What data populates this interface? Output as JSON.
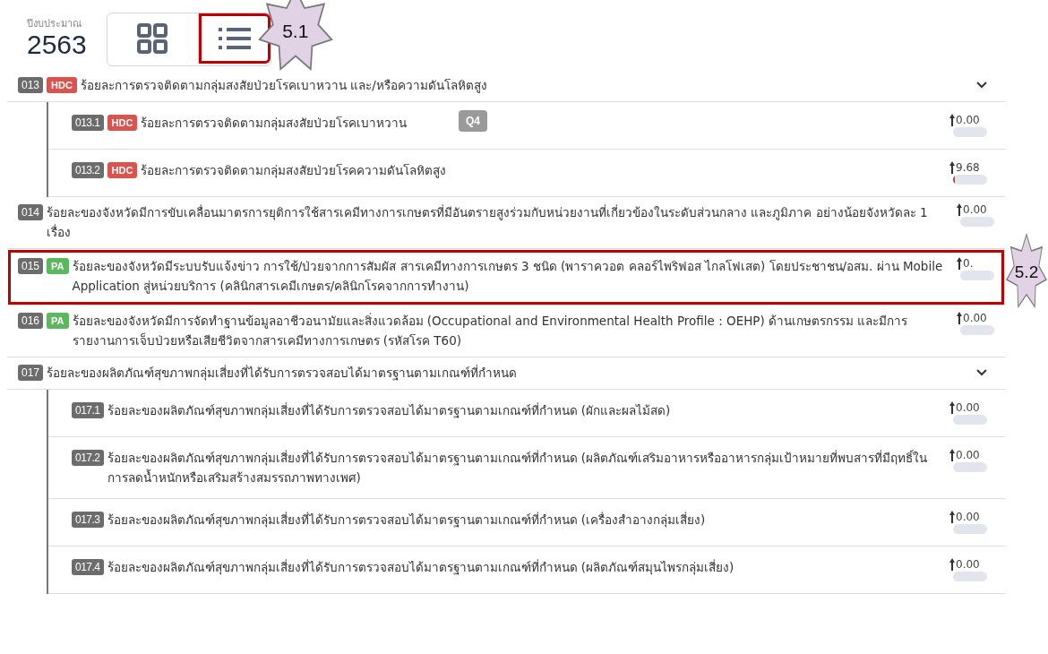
{
  "header": {
    "budget_label": "ปีงบประมาณ",
    "year": "2563"
  },
  "view_toggle": [
    {
      "kind": "grid",
      "selected": false,
      "highlighted": false
    },
    {
      "kind": "list",
      "selected": true,
      "highlighted": true,
      "callout": "5.1"
    }
  ],
  "items": [
    {
      "code": "013",
      "tag": {
        "label": "HDC",
        "color": "#d9534f"
      },
      "text": "ร้อยละการตรวจติดตามกลุ่มสงสัยป่วยโรคเบาหวาน และ/หรือความดันโลหิตสูง",
      "expanded": true,
      "highlighted": false,
      "children": [
        {
          "code": "013.1",
          "tag": {
            "label": "HDC",
            "color": "#d9534f"
          },
          "text": "ร้อยละการตรวจติดตามกลุ่มสงสัยป่วยโรคเบาหวาน",
          "tooltip": "Q4",
          "value": "0.00",
          "level": 0
        },
        {
          "code": "013.2",
          "tag": {
            "label": "HDC",
            "color": "#d9534f"
          },
          "text": "ร้อยละการตรวจติดตามกลุ่มสงสัยป่วยโรคความดันโลหิตสูง",
          "value": "9.68",
          "level": 0.04
        }
      ]
    },
    {
      "code": "014",
      "text": "ร้อยละของจังหวัดมีการขับเคลื่อนมาตรการยุติการใช้สารเคมีทางการเกษตรที่มีอันตรายสูงร่วมกับหน่วยงานที่เกี่ยวข้องในระดับส่วนกลาง และภูมิภาค อย่างน้อยจังหวัดละ 1 เรื่อง",
      "value": "0.00",
      "level": 0,
      "highlighted": false
    },
    {
      "code": "015",
      "tag": {
        "label": "PA",
        "color": "#5cb85c"
      },
      "text": "ร้อยละของจังหวัดมีระบบรับแจ้งข่าว การใช้/ป่วยจากการสัมผัส สารเคมีทางการเกษตร 3 ชนิด (พาราควอต คลอร์ไพริฟอส ไกลโฟเสต) โดยประชาชน/อสม. ผ่าน Mobile Application สู่หน่วยบริการ (คลินิกสารเคมีเกษตร/คลินิกโรคจากการทำงาน)",
      "value": "0.",
      "level": 0,
      "highlighted": true,
      "callout": "5.2"
    },
    {
      "code": "016",
      "tag": {
        "label": "PA",
        "color": "#5cb85c"
      },
      "text": "ร้อยละของจังหวัดมีการจัดทำฐานข้อมูลอาชีวอนามัยและสิ่งแวดล้อม (Occupational and Environmental Health Profile : OEHP) ด้านเกษตรกรรม และมีการรายงานการเจ็บป่วยหรือเสียชีวิตจากสารเคมีทางการเกษตร (รหัสโรค T60)",
      "value": "0.00",
      "level": 0,
      "highlighted": false
    },
    {
      "code": "017",
      "text": "ร้อยละของผลิตภัณฑ์สุขภาพกลุ่มเสี่ยงที่ได้รับการตรวจสอบได้มาตรฐานตามเกณฑ์ที่กำหนด",
      "expanded": true,
      "highlighted": false,
      "children": [
        {
          "code": "017.1",
          "text": "ร้อยละของผลิตภัณฑ์สุขภาพกลุ่มเสี่ยงที่ได้รับการตรวจสอบได้มาตรฐานตามเกณฑ์ที่กำหนด (ผักและผลไม้สด)",
          "value": "0.00",
          "level": 0
        },
        {
          "code": "017.2",
          "text": "ร้อยละของผลิตภัณฑ์สุขภาพกลุ่มเสี่ยงที่ได้รับการตรวจสอบได้มาตรฐานตามเกณฑ์ที่กำหนด (ผลิตภัณฑ์เสริมอาหารหรืออาหารกลุ่มเป้าหมายที่พบสารที่มีฤทธิ์ในการลดน้ำหนักหรือเสริมสร้างสมรรถภาพทางเพศ)",
          "value": "0.00",
          "level": 0
        },
        {
          "code": "017.3",
          "text": "ร้อยละของผลิตภัณฑ์สุขภาพกลุ่มเสี่ยงที่ได้รับการตรวจสอบได้มาตรฐานตามเกณฑ์ที่กำหนด (เครื่องสำอางกลุ่มเสี่ยง)",
          "value": "0.00",
          "level": 0
        },
        {
          "code": "017.4",
          "text": "ร้อยละของผลิตภัณฑ์สุขภาพกลุ่มเสี่ยงที่ได้รับการตรวจสอบได้มาตรฐานตามเกณฑ์ที่กำหนด (ผลิตภัณฑ์สมุนไพรกลุ่มเสี่ยง)",
          "value": "0.00",
          "level": 0
        }
      ]
    }
  ]
}
